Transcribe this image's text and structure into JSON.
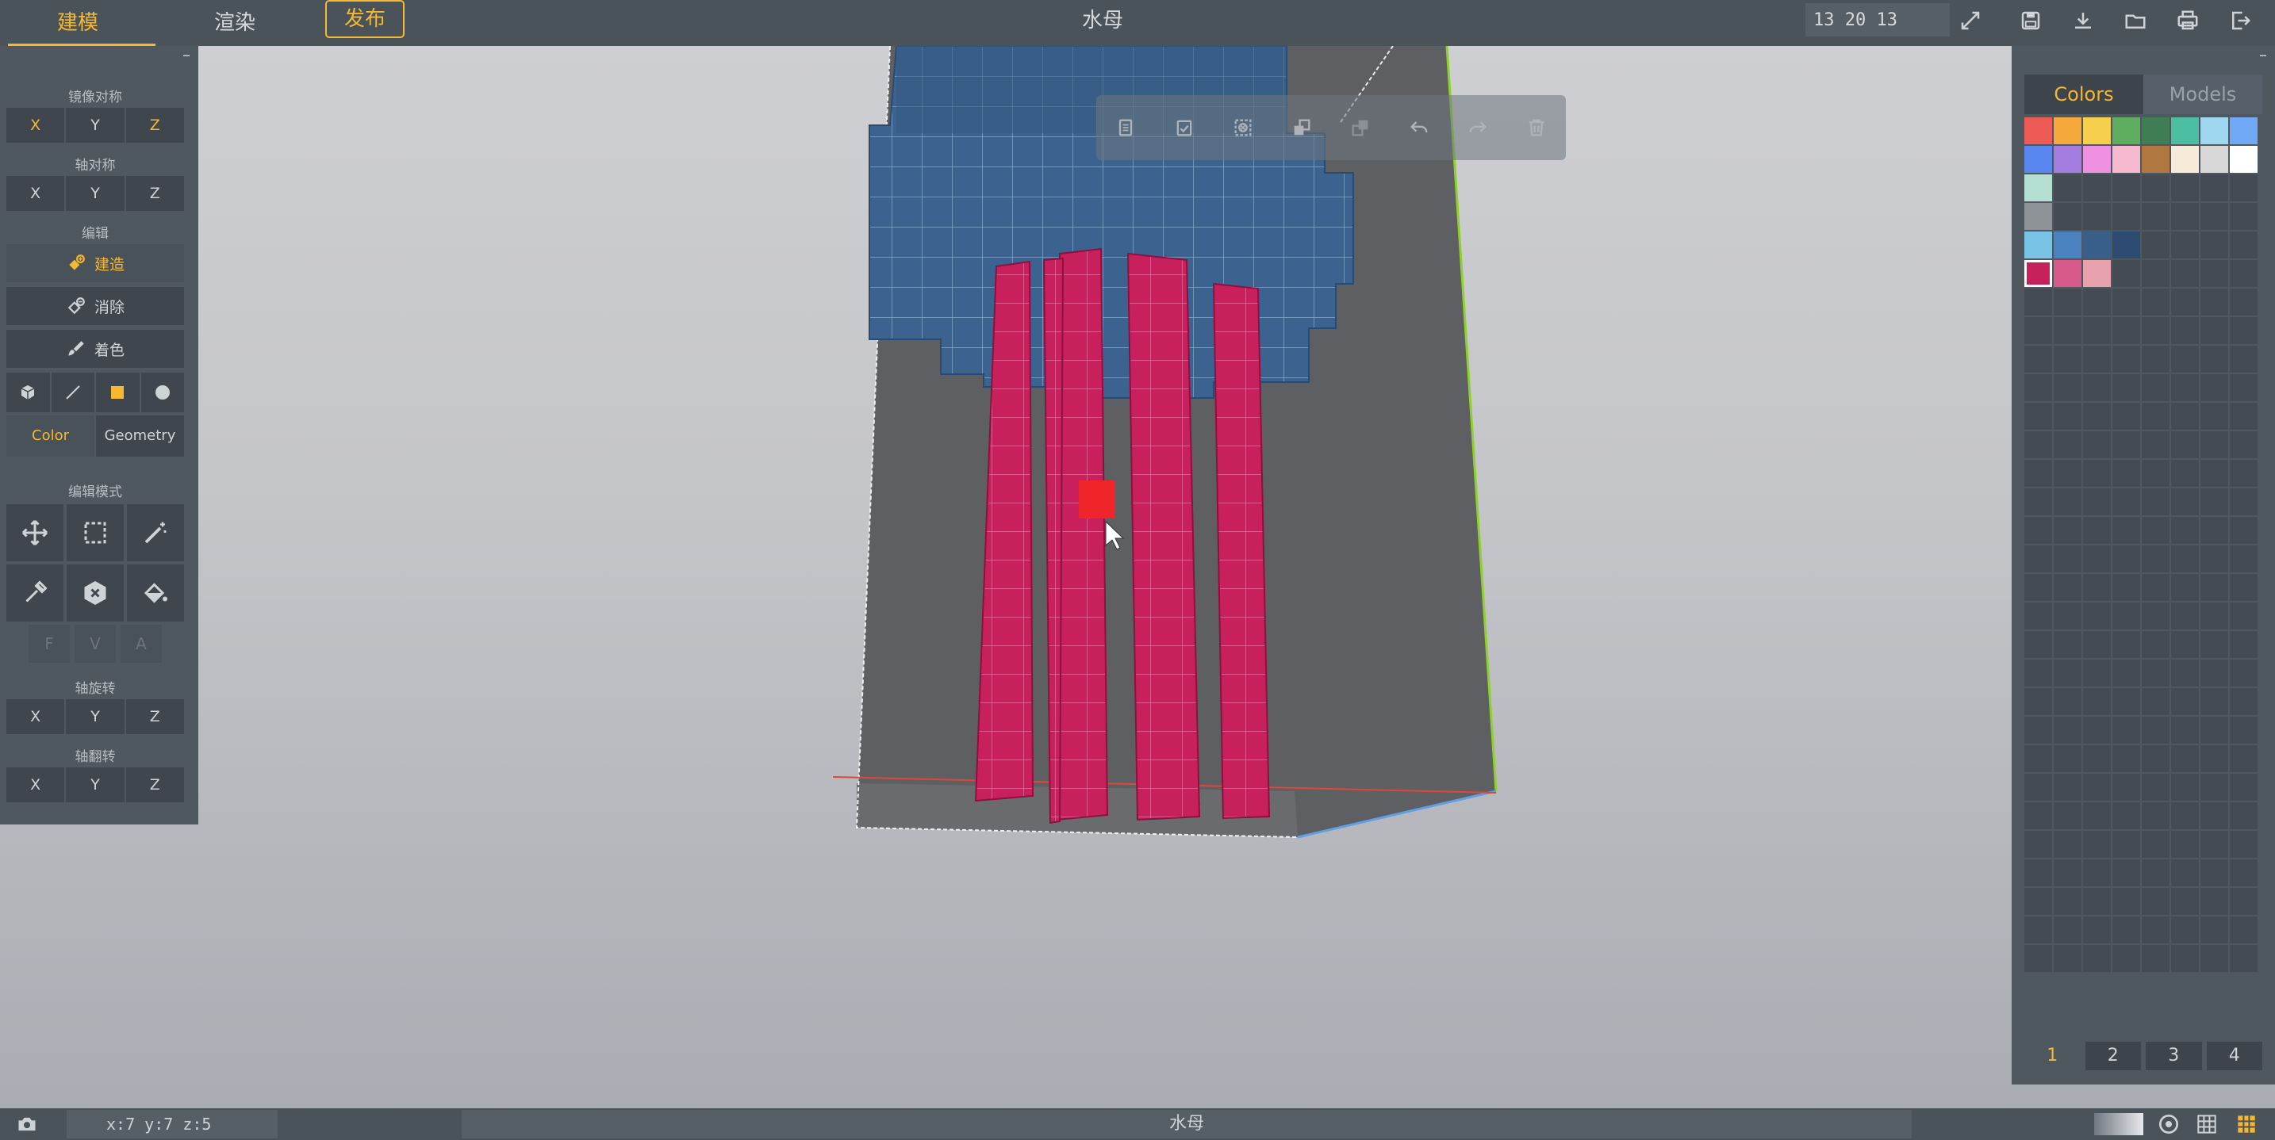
{
  "app": {
    "tabs": {
      "model": "建模",
      "render": "渲染",
      "publish": "发布"
    },
    "document_title": "水母",
    "dimensions": "13 20 13",
    "accent": "#f5b82e"
  },
  "left_panel": {
    "mirror": {
      "title": "镜像对称",
      "x": "X",
      "y": "Y",
      "z": "Z",
      "active": "X,Z"
    },
    "axis_sym": {
      "title": "轴对称",
      "x": "X",
      "y": "Y",
      "z": "Z"
    },
    "edit": {
      "title": "编辑",
      "build": "建造",
      "erase": "消除",
      "paint": "着色"
    },
    "color_toggle": {
      "color": "Color",
      "geometry": "Geometry"
    },
    "edit_mode": {
      "title": "编辑模式",
      "f": "F",
      "v": "V",
      "a": "A"
    },
    "rotate": {
      "title": "轴旋转",
      "x": "X",
      "y": "Y",
      "z": "Z"
    },
    "flip": {
      "title": "轴翻转",
      "x": "X",
      "y": "Y",
      "z": "Z"
    }
  },
  "right_panel": {
    "tabs": {
      "colors": "Colors",
      "models": "Models"
    },
    "palette": [
      "#ee5a55",
      "#f4a93a",
      "#f6d04d",
      "#5fae60",
      "#3f7d55",
      "#4cbfa3",
      "#9fd6f0",
      "#6fa8f5",
      "#5a86f0",
      "#a57de0",
      "#f090e0",
      "#f6b8cf",
      "#b07840",
      "#f7ead8",
      "#d8d8d8",
      "#ffffff",
      "#b6dfd4",
      "",
      "",
      "",
      "",
      "",
      "",
      "",
      "#8e9397",
      "",
      "",
      "",
      "",
      "",
      "",
      "",
      "#79c3e6",
      "#4a82c0",
      "#375f8a",
      "#2d4b72",
      "",
      "",
      "",
      "",
      "#c8205d",
      "#d85a8a",
      "#e8a2ae",
      "",
      "",
      "",
      "",
      ""
    ],
    "selected_color_index": 40,
    "pages": [
      "1",
      "2",
      "3",
      "4"
    ],
    "active_page": "1"
  },
  "status_bar": {
    "coords": "x:7 y:7 z:5",
    "title": "水母"
  },
  "icons": [
    "compress-icon",
    "save-icon",
    "download-icon",
    "open-folder-icon",
    "print-icon",
    "exit-icon",
    "copy-icon",
    "paste-icon",
    "deselect-icon",
    "duplicate-icon",
    "merge-icon",
    "undo-icon",
    "redo-icon",
    "trash-icon",
    "move-icon",
    "select-box-icon",
    "magic-wand-icon",
    "eyedropper-icon",
    "delete-voxel-icon",
    "fill-bucket-icon",
    "cube-icon",
    "line-icon",
    "square-icon",
    "sphere-icon",
    "camera-icon",
    "gradient-swatch-icon",
    "target-icon",
    "grid-icon",
    "grid-fill-icon"
  ]
}
